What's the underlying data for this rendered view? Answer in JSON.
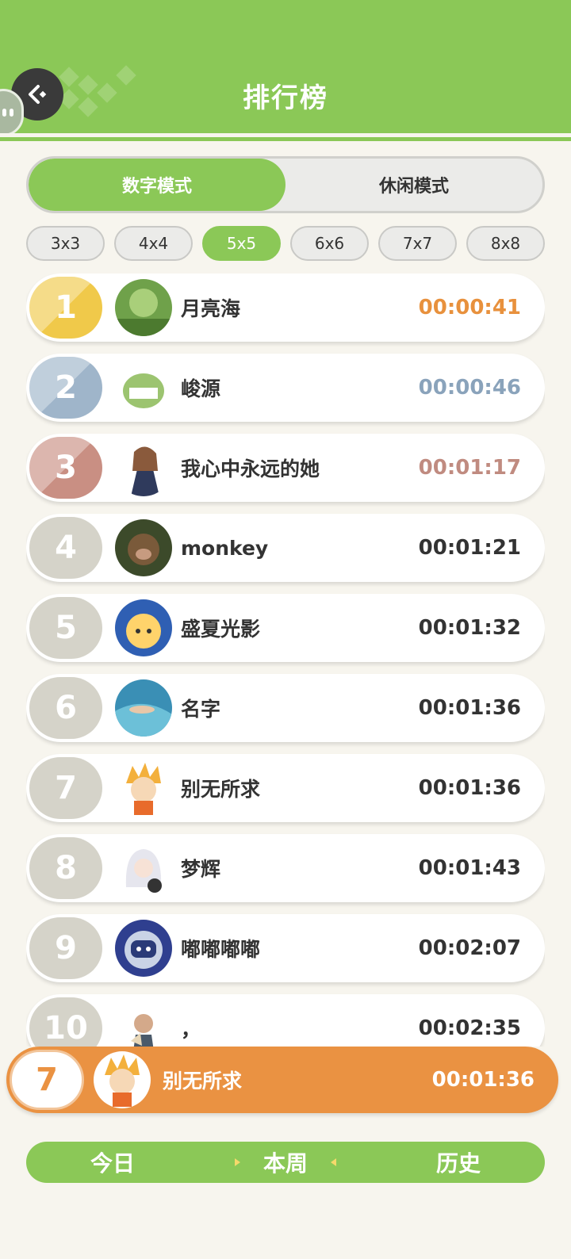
{
  "header": {
    "title": "排行榜"
  },
  "modes": [
    {
      "label": "数字模式",
      "active": true
    },
    {
      "label": "休闲模式",
      "active": false
    }
  ],
  "sizes": [
    {
      "label": "3x3"
    },
    {
      "label": "4x4"
    },
    {
      "label": "5x5",
      "active": true
    },
    {
      "label": "6x6"
    },
    {
      "label": "7x7"
    },
    {
      "label": "8x8"
    }
  ],
  "ranking": [
    {
      "rank": "1",
      "name": "月亮海",
      "time": "00:00:41",
      "rank_color": "#f0c94a",
      "time_color": "#e8913d"
    },
    {
      "rank": "2",
      "name": "峻源",
      "time": "00:00:46",
      "rank_color": "#9fb5ca",
      "time_color": "#8aa3bb"
    },
    {
      "rank": "3",
      "name": "我心中永远的她",
      "time": "00:01:17",
      "rank_color": "#c98f83",
      "time_color": "#c08b80"
    },
    {
      "rank": "4",
      "name": "monkey",
      "time": "00:01:21",
      "rank_color": "#d5d3c9"
    },
    {
      "rank": "5",
      "name": "盛夏光影",
      "time": "00:01:32",
      "rank_color": "#d5d3c9"
    },
    {
      "rank": "6",
      "name": "名字",
      "time": "00:01:36",
      "rank_color": "#d5d3c9"
    },
    {
      "rank": "7",
      "name": "别无所求",
      "time": "00:01:36",
      "rank_color": "#d5d3c9"
    },
    {
      "rank": "8",
      "name": "梦辉",
      "time": "00:01:43",
      "rank_color": "#d5d3c9"
    },
    {
      "rank": "9",
      "name": "嘟嘟嘟嘟",
      "time": "00:02:07",
      "rank_color": "#d5d3c9"
    },
    {
      "rank": "10",
      "name": "，",
      "time": "00:02:35",
      "rank_color": "#d5d3c9"
    }
  ],
  "my_rank": {
    "rank": "7",
    "name": "别无所求",
    "time": "00:01:36"
  },
  "periods": [
    {
      "label": "今日"
    },
    {
      "label": "本周",
      "active": true
    },
    {
      "label": "历史"
    }
  ],
  "colors": {
    "brand_green": "#8bc857",
    "my_rank_orange": "#ea9242"
  }
}
